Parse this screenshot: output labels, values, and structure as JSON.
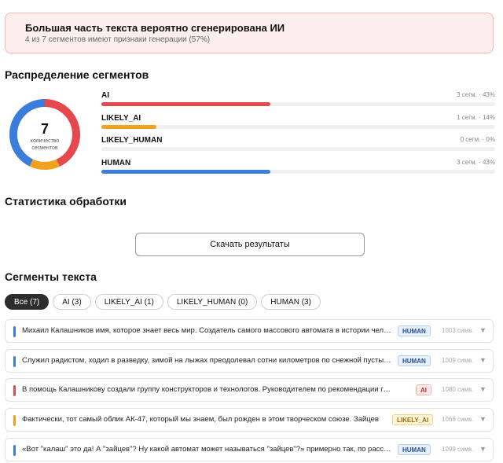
{
  "banner": {
    "title": "Большая часть текста вероятно сгенерирована ИИ",
    "subtitle": "4 из 7 сегментов имеют признаки генерации (57%)"
  },
  "distribution": {
    "heading": "Распределение сегментов",
    "total": "7",
    "total_caption_1": "количество",
    "total_caption_2": "сегментов",
    "rows": [
      {
        "label": "AI",
        "stat": "3 сегм. · 43%",
        "fraction": 0.43,
        "color": "#e5484d"
      },
      {
        "label": "LIKELY_AI",
        "stat": "1 сегм. · 14%",
        "fraction": 0.14,
        "color": "#f0a21e"
      },
      {
        "label": "LIKELY_HUMAN",
        "stat": "0 сегм. · 0%",
        "fraction": 0.0,
        "color": "#9cc3ff"
      },
      {
        "label": "HUMAN",
        "stat": "3 сегм. · 43%",
        "fraction": 0.43,
        "color": "#3b7ddd"
      }
    ]
  },
  "stats": {
    "heading": "Статистика обработки",
    "download_label": "Скачать результаты"
  },
  "segments": {
    "heading": "Сегменты текста",
    "filters": [
      {
        "label": "Все (7)",
        "active": true
      },
      {
        "label": "AI (3)",
        "active": false
      },
      {
        "label": "LIKELY_AI (1)",
        "active": false
      },
      {
        "label": "LIKELY_HUMAN (0)",
        "active": false
      },
      {
        "label": "HUMAN (3)",
        "active": false
      }
    ],
    "items": [
      {
        "text": "Михаил Калашников имя, которое знает весь мир. Создатель самого массового автомата в истории человечества",
        "label": "HUMAN",
        "count": "1003 симв."
      },
      {
        "text": "Служил радистом, ходил в разведку, зимой на лыжах преодолевал сотни километров по снежной пустыне",
        "label": "HUMAN",
        "count": "1009 симв."
      },
      {
        "text": "В помощь Калашникову создали группу конструкторов и технологов. Руководителем по рекомендации главного",
        "label": "AI",
        "count": "1080 симв."
      },
      {
        "text": "Фактически, тот самый облик АК-47, который мы знаем, был рожден в этом творческом союзе. Зайцев",
        "label": "LIKELY_AI",
        "count": "1066 симв."
      },
      {
        "text": "«Вот \"калаш\" это да! А \"зайцев\"? Ну какой автомат может называться \"зайцев\"?» примерно так, по рассказам",
        "label": "HUMAN",
        "count": "1099 симв."
      }
    ]
  },
  "label_styles": {
    "AI": {
      "bar": "#e5484d",
      "bg": "#fde8e8",
      "border": "#f2b4b4",
      "fg": "#c62828"
    },
    "LIKELY_AI": {
      "bar": "#f0a21e",
      "bg": "#fff4d6",
      "border": "#f0d38a",
      "fg": "#9a6a00"
    },
    "LIKELY_HUMAN": {
      "bar": "#9cc3ff",
      "bg": "#eef5ff",
      "border": "#c6dcfb",
      "fg": "#2f5fa7"
    },
    "HUMAN": {
      "bar": "#3b7ddd",
      "bg": "#e8f0fc",
      "border": "#b9cff0",
      "fg": "#1f4f99"
    }
  }
}
